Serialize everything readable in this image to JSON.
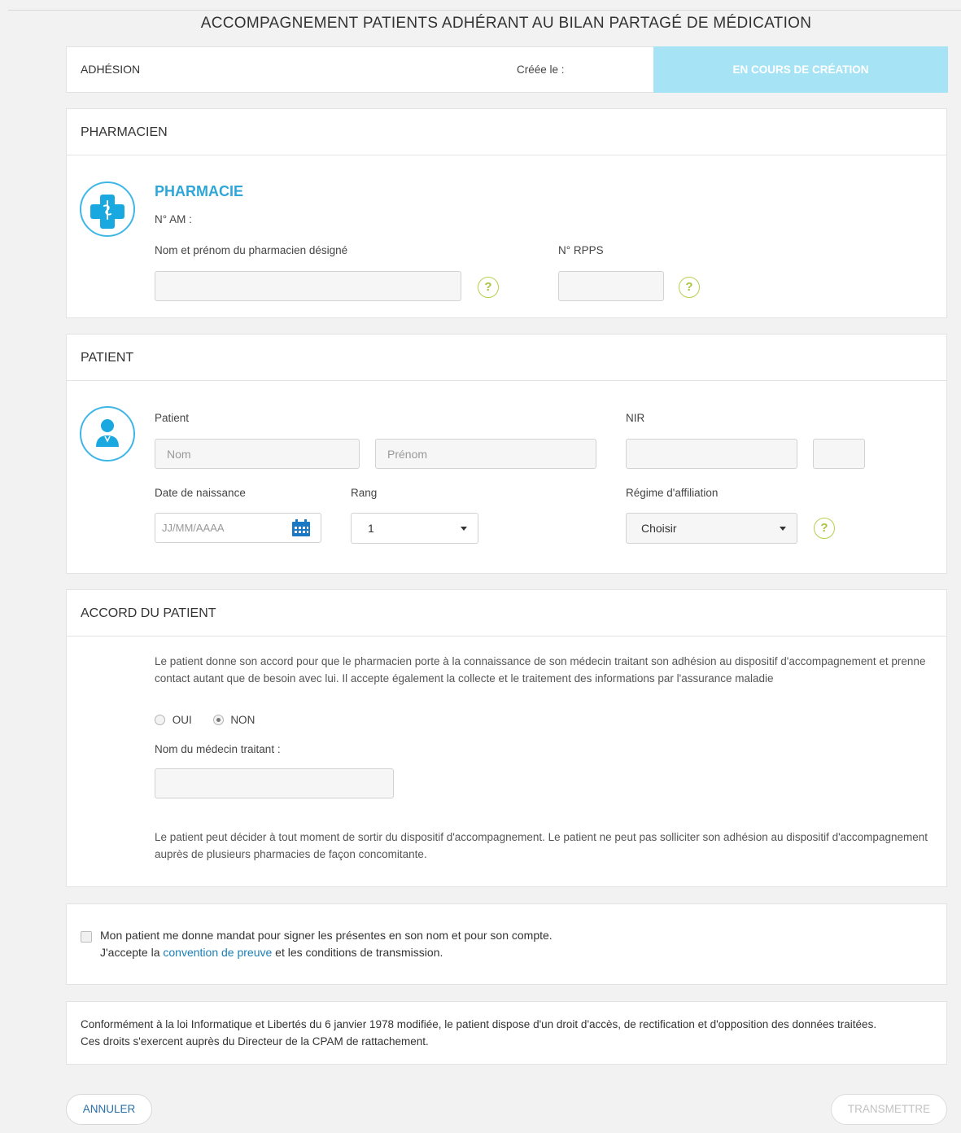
{
  "page": {
    "title": "ACCOMPAGNEMENT PATIENTS ADHÉRANT AU BILAN PARTAGÉ DE MÉDICATION"
  },
  "adhesion": {
    "label": "ADHÉSION",
    "created_label": "Créée le :",
    "status": "EN COURS DE CRÉATION",
    "status_color": "#a6e3f5"
  },
  "pharmacien": {
    "header": "PHARMACIEN",
    "pharmacie_name": "PHARMACIE",
    "am_label": "N° AM :",
    "nom_label": "Nom et prénom du pharmacien désigné",
    "rpps_label": "N° RPPS",
    "help": "?"
  },
  "patient": {
    "header": "PATIENT",
    "patient_label": "Patient",
    "nom_placeholder": "Nom",
    "prenom_placeholder": "Prénom",
    "nir_label": "NIR",
    "dob_label": "Date de naissance",
    "dob_placeholder": "JJ/MM/AAAA",
    "rang_label": "Rang",
    "rang_value": "1",
    "regime_label": "Régime d'affiliation",
    "regime_value": "Choisir",
    "help": "?"
  },
  "accord": {
    "header": "ACCORD DU PATIENT",
    "text": "Le patient donne son accord pour que le pharmacien porte à la connaissance de son médecin traitant son adhésion au dispositif d'accompagnement et prenne contact autant que de besoin avec lui. Il accepte également la collecte et le traitement des informations par l'assurance maladie",
    "oui": "OUI",
    "non": "NON",
    "selected": "NON",
    "medecin_label": "Nom du médecin traitant :",
    "footer_text": "Le patient peut décider à tout moment de sortir du dispositif d'accompagnement. Le patient ne peut pas solliciter son adhésion au dispositif d'accompagnement auprès de plusieurs pharmacies de façon concomitante."
  },
  "mandat": {
    "line1": "Mon patient me donne mandat pour signer les présentes en son nom et pour son compte.",
    "line2_prefix": "J'accepte la ",
    "link": "convention de preuve",
    "line2_suffix": " et les conditions de transmission.",
    "link_color": "#1a7fb6"
  },
  "legal": {
    "text": "Conformément à la loi Informatique et Libertés du 6 janvier 1978 modifiée, le patient dispose d'un droit d'accès, de rectification et d'opposition des données traitées. Ces droits s'exercent auprès du Directeur de la CPAM de rattachement."
  },
  "actions": {
    "cancel": "ANNULER",
    "submit": "TRANSMETTRE"
  }
}
